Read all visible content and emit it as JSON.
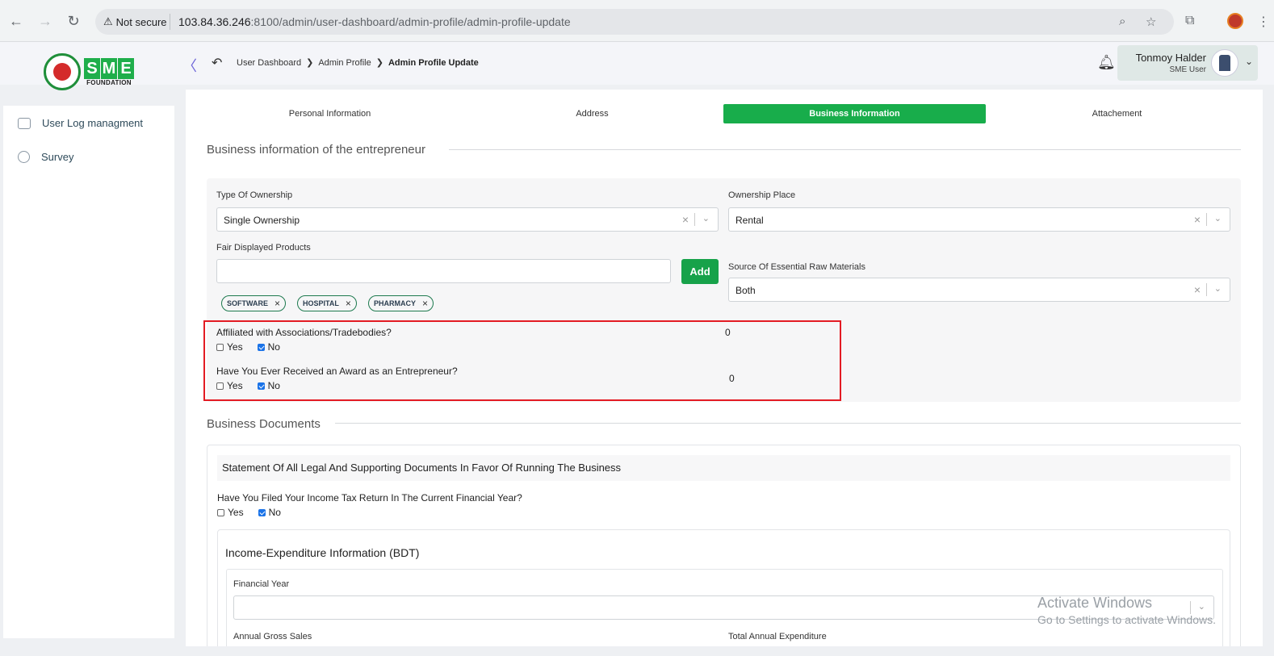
{
  "browser": {
    "security_label": "Not secure",
    "url_host": "103.84.36.246",
    "url_rest": ":8100/admin/user-dashboard/admin-profile/admin-profile-update"
  },
  "header": {
    "logo_letters": [
      "S",
      "M",
      "E"
    ],
    "logo_sub": "FOUNDATION",
    "breadcrumb": [
      "User Dashboard",
      "Admin Profile",
      "Admin Profile Update"
    ],
    "user_name": "Tonmoy Halder",
    "user_role": "SME User"
  },
  "sidebar": {
    "items": [
      {
        "label": "User Log managment",
        "icon": "log-icon"
      },
      {
        "label": "Survey",
        "icon": "pie-chart-icon"
      }
    ]
  },
  "tabs": [
    {
      "label": "Personal Information",
      "active": false
    },
    {
      "label": "Address",
      "active": false
    },
    {
      "label": "Business Information",
      "active": true
    },
    {
      "label": "Attachement",
      "active": false
    }
  ],
  "business": {
    "section_title": "Business information of the entrepreneur",
    "ownership_type_label": "Type Of Ownership",
    "ownership_type_value": "Single Ownership",
    "ownership_place_label": "Ownership Place",
    "ownership_place_value": "Rental",
    "fair_products_label": "Fair Displayed Products",
    "fair_products_value": "",
    "add_label": "Add",
    "chips": [
      "SOFTWARE",
      "HOSPITAL",
      "PHARMACY"
    ],
    "raw_materials_label": "Source Of Essential Raw Materials",
    "raw_materials_value": "Both",
    "affiliated_q": "Affiliated with Associations/Tradebodies?",
    "affiliated_count": "0",
    "award_q": "Have You Ever Received an Award as an Entrepreneur?",
    "award_count": "0",
    "yes_label": "Yes",
    "no_label": "No"
  },
  "documents": {
    "section_title": "Business Documents",
    "statement_title": "Statement Of All Legal And Supporting Documents In Favor Of Running The Business",
    "tax_q": "Have You Filed Your Income Tax Return In The Current Financial Year?",
    "income_title": "Income-Expenditure Information (BDT)",
    "financial_year_label": "Financial Year",
    "annual_sales_label": "Annual Gross Sales",
    "total_expenditure_label": "Total Annual Expenditure"
  },
  "watermark": {
    "line1": "Activate Windows",
    "line2": "Go to Settings to activate Windows."
  }
}
